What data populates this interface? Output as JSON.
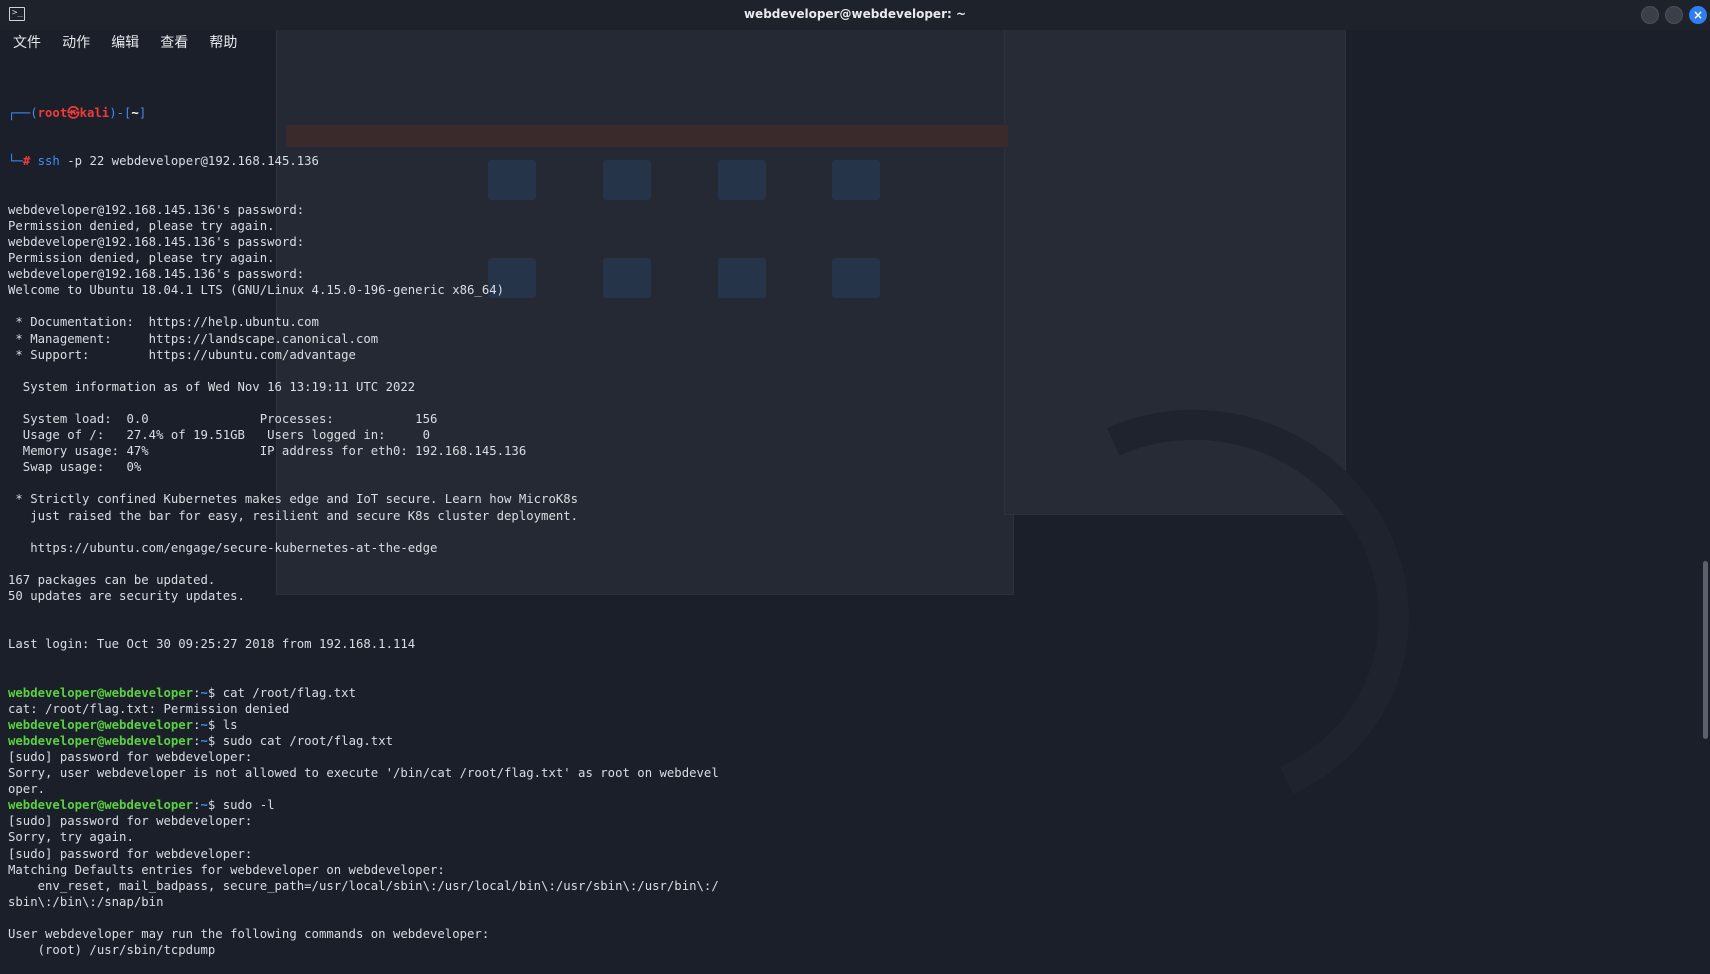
{
  "window": {
    "title": "webdeveloper@webdeveloper: ~"
  },
  "menu": [
    "文件",
    "动作",
    "编辑",
    "查看",
    "帮助"
  ],
  "prompt_root": {
    "user": "root",
    "at": "㉿",
    "host": "kali",
    "path": "~",
    "symbol": "#"
  },
  "root_command": "ssh -p 22 webdeveloper@192.168.145.136",
  "remote_prompt": {
    "user_host": "webdeveloper@webdeveloper",
    "path": "~",
    "symbol": "$"
  },
  "lines": [
    "webdeveloper@192.168.145.136's password: ",
    "Permission denied, please try again.",
    "webdeveloper@192.168.145.136's password: ",
    "Permission denied, please try again.",
    "webdeveloper@192.168.145.136's password: ",
    "Welcome to Ubuntu 18.04.1 LTS (GNU/Linux 4.15.0-196-generic x86_64)",
    "",
    " * Documentation:  https://help.ubuntu.com",
    " * Management:     https://landscape.canonical.com",
    " * Support:        https://ubuntu.com/advantage",
    "",
    "  System information as of Wed Nov 16 13:19:11 UTC 2022",
    "",
    "  System load:  0.0               Processes:           156",
    "  Usage of /:   27.4% of 19.51GB   Users logged in:     0",
    "  Memory usage: 47%               IP address for eth0: 192.168.145.136",
    "  Swap usage:   0%",
    "",
    " * Strictly confined Kubernetes makes edge and IoT secure. Learn how MicroK8s",
    "   just raised the bar for easy, resilient and secure K8s cluster deployment.",
    "",
    "   https://ubuntu.com/engage/secure-kubernetes-at-the-edge",
    "",
    "167 packages can be updated.",
    "50 updates are security updates.",
    "",
    "",
    "Last login: Tue Oct 30 09:25:27 2018 from 192.168.1.114"
  ],
  "session": [
    {
      "type": "prompt",
      "cmd": "cat /root/flag.txt"
    },
    {
      "type": "out",
      "text": "cat: /root/flag.txt: Permission denied"
    },
    {
      "type": "prompt",
      "cmd": "ls"
    },
    {
      "type": "prompt",
      "cmd": "sudo cat /root/flag.txt"
    },
    {
      "type": "out",
      "text": "[sudo] password for webdeveloper: "
    },
    {
      "type": "out",
      "text": "Sorry, user webdeveloper is not allowed to execute '/bin/cat /root/flag.txt' as root on webdevel"
    },
    {
      "type": "out",
      "text": "oper."
    },
    {
      "type": "prompt",
      "cmd": "sudo -l"
    },
    {
      "type": "out",
      "text": "[sudo] password for webdeveloper: "
    },
    {
      "type": "out",
      "text": "Sorry, try again."
    },
    {
      "type": "out",
      "text": "[sudo] password for webdeveloper: "
    },
    {
      "type": "out",
      "text": "Matching Defaults entries for webdeveloper on webdeveloper:"
    },
    {
      "type": "out",
      "text": "    env_reset, mail_badpass, secure_path=/usr/local/sbin\\:/usr/local/bin\\:/usr/sbin\\:/usr/bin\\:/"
    },
    {
      "type": "out",
      "text": "sbin\\:/bin\\:/snap/bin"
    },
    {
      "type": "out",
      "text": ""
    },
    {
      "type": "out",
      "text": "User webdeveloper may run the following commands on webdeveloper:"
    },
    {
      "type": "out",
      "text": "    (root) /usr/sbin/tcpdump"
    }
  ],
  "colors": {
    "background": "#1b1f29",
    "prompt_user": "#5ad23f",
    "prompt_path": "#3f8df6",
    "root_user": "#ef3b3b",
    "close_button": "#2f7ff0"
  },
  "icons": [
    "terminal-icon",
    "minimize-icon",
    "maximize-icon",
    "close-icon"
  ]
}
